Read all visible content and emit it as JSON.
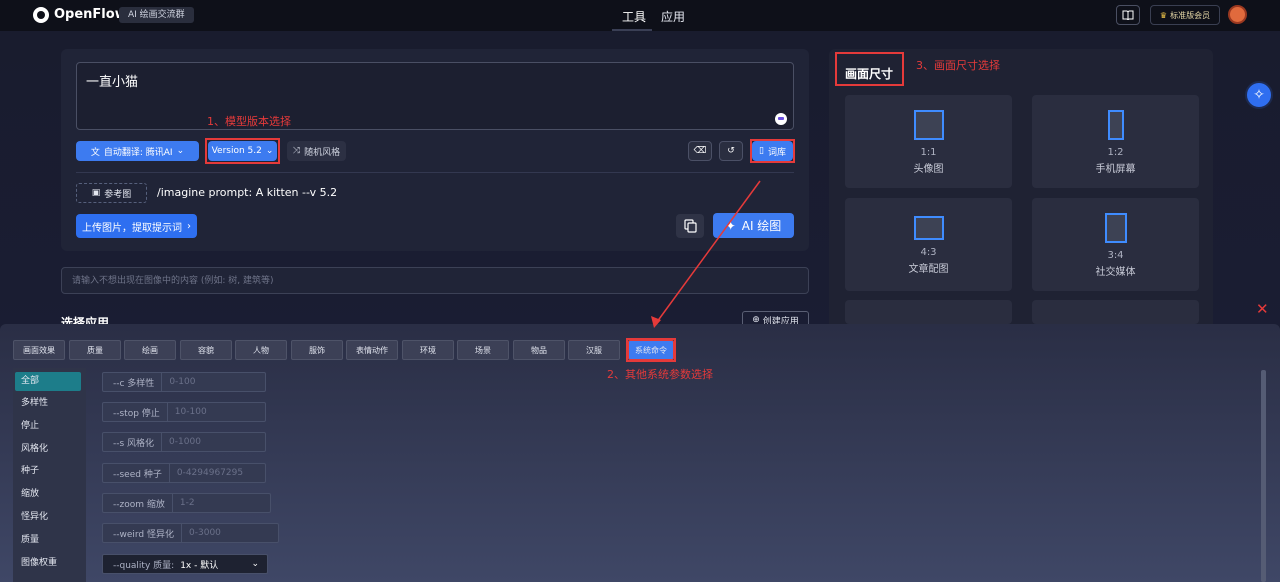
{
  "header": {
    "brand": "OpenFlow",
    "group": "AI 绘画交流群",
    "nav": [
      "工具",
      "应用"
    ],
    "member": "标准版会员"
  },
  "prompt": {
    "text": "一直小猫",
    "translate": "自动翻译:  腾讯AI",
    "version": "Version 5.2",
    "random_style": "随机风格",
    "lexicon": "词库",
    "ref_image": "参考图",
    "imagine": "/imagine prompt:  A kitten --v 5.2",
    "upload": "上传图片，提取提示词",
    "ai_draw": "AI 绘图",
    "negative_placeholder": "请输入不想出现在图像中的内容 (例如: 树, 建筑等)"
  },
  "apps": {
    "title": "选择应用",
    "create": "创建应用"
  },
  "annotations": {
    "a1": "1、模型版本选择",
    "a2": "2、其他系统参数选择",
    "a3": "3、画面尺寸选择"
  },
  "size_panel": {
    "title": "画面尺寸",
    "cards": [
      {
        "ratio": "1:1",
        "name": "头像图"
      },
      {
        "ratio": "1:2",
        "name": "手机屏幕"
      },
      {
        "ratio": "4:3",
        "name": "文章配图"
      },
      {
        "ratio": "3:4",
        "name": "社交媒体"
      }
    ]
  },
  "tabs": [
    "画面效果",
    "质量",
    "绘画",
    "容貌",
    "人物",
    "服饰",
    "表情动作",
    "环境",
    "场景",
    "物品",
    "汉服",
    "系统命令"
  ],
  "sidebar": [
    "全部",
    "多样性",
    "停止",
    "风格化",
    "种子",
    "缩放",
    "怪异化",
    "质量",
    "图像权重"
  ],
  "params": [
    {
      "label": "--c 多样性",
      "placeholder": "0-100"
    },
    {
      "label": "--stop 停止",
      "placeholder": "10-100"
    },
    {
      "label": "--s 风格化",
      "placeholder": "0-1000"
    },
    {
      "label": "--seed 种子",
      "placeholder": "0-4294967295"
    },
    {
      "label": "--zoom 缩放",
      "placeholder": "1-2"
    },
    {
      "label": "--weird 怪异化",
      "placeholder": "0-3000"
    }
  ],
  "quality": {
    "label": "--quality 质量:",
    "value": "1x - 默认"
  },
  "colors": {
    "accent": "#3d7bf0",
    "annotation": "#e53a3a"
  }
}
